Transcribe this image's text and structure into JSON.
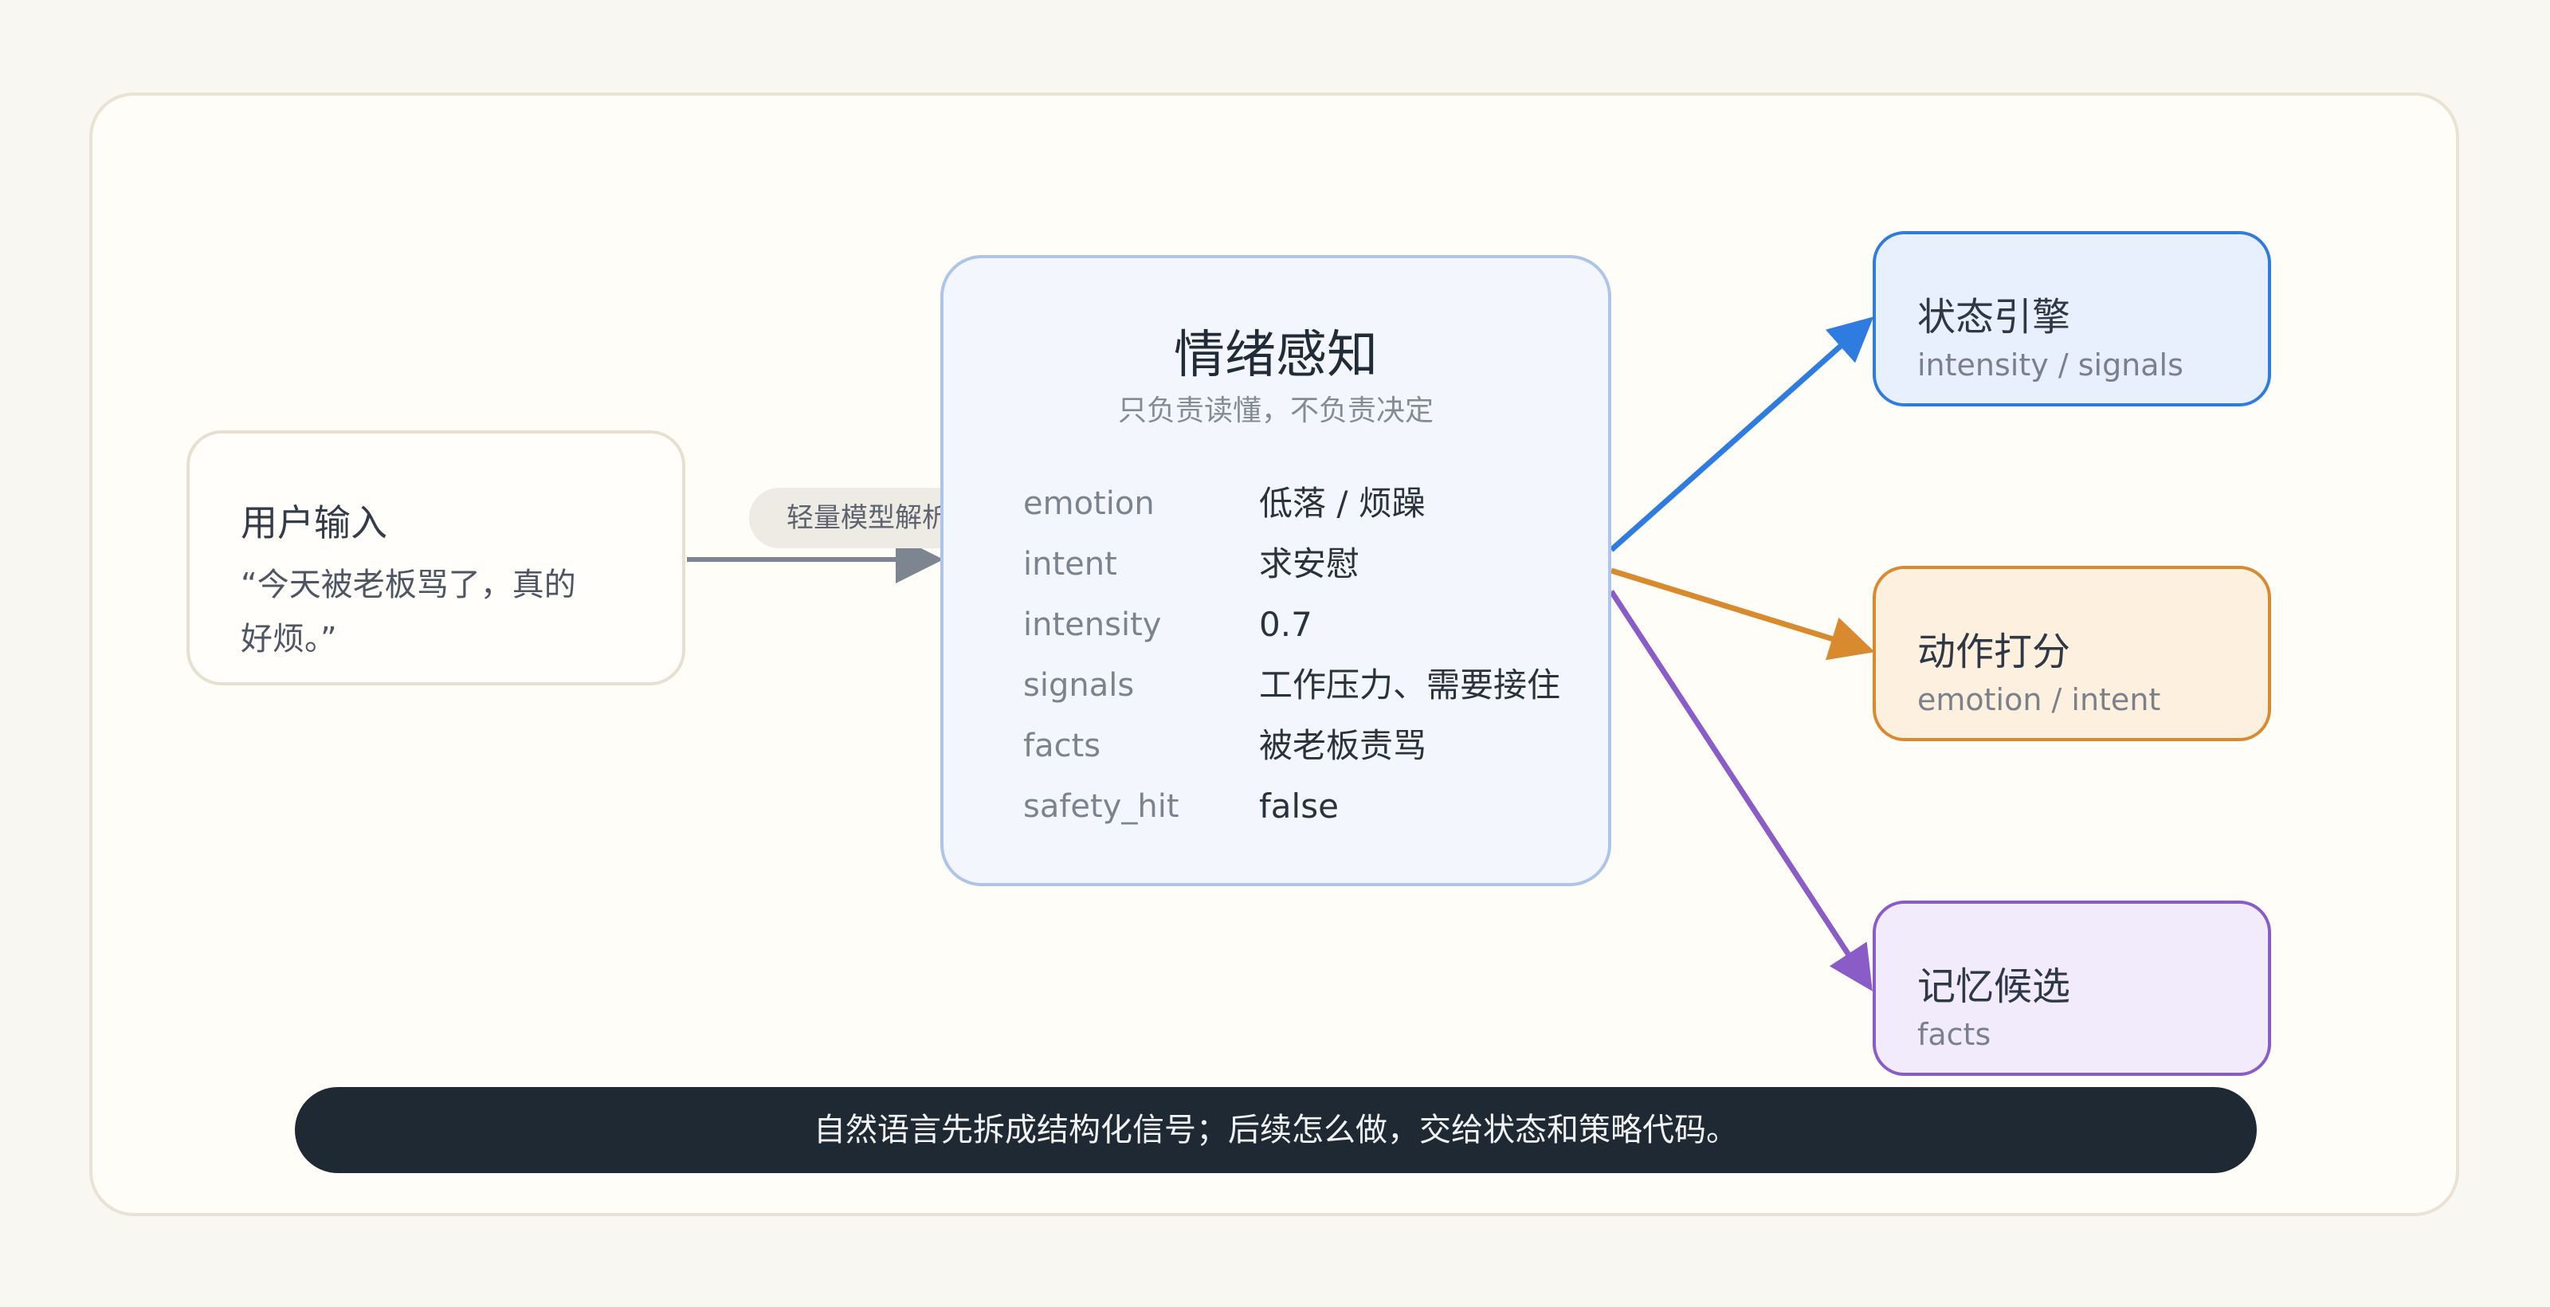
{
  "colors": {
    "state_engine": "#2f7ce0",
    "action_scoring": "#d9892e",
    "memory": "#8a5cc8",
    "input_edge": "#7d8591",
    "footer_bg": "#1e2933"
  },
  "input": {
    "title": "用户输入",
    "quote": "“今天被老板骂了，真的好烦。”"
  },
  "edge_label": "轻量模型解析",
  "perception": {
    "title": "情绪感知",
    "subtitle": "只负责读懂，不负责决定",
    "fields": [
      {
        "key": "emotion",
        "value": "低落 / 烦躁"
      },
      {
        "key": "intent",
        "value": "求安慰"
      },
      {
        "key": "intensity",
        "value": "0.7"
      },
      {
        "key": "signals",
        "value": "工作压力、需要接住"
      },
      {
        "key": "facts",
        "value": "被老板责骂"
      },
      {
        "key": "safety_hit",
        "value": "false"
      }
    ]
  },
  "targets": [
    {
      "title": "状态引擎",
      "subtitle": "intensity / signals"
    },
    {
      "title": "动作打分",
      "subtitle": "emotion / intent"
    },
    {
      "title": "记忆候选",
      "subtitle": "facts"
    }
  ],
  "footer": "自然语言先拆成结构化信号；后续怎么做，交给状态和策略代码。"
}
